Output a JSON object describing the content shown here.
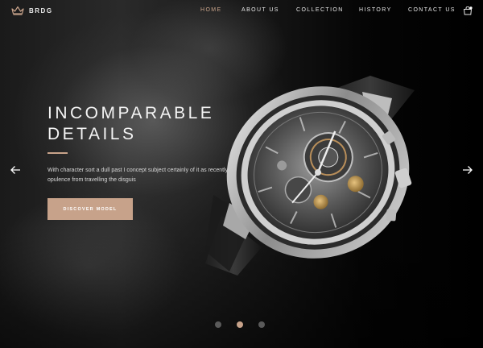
{
  "brand": {
    "name": "BRDG",
    "icon": "crown-icon"
  },
  "nav": {
    "items": [
      {
        "label": "HOME",
        "active": true
      },
      {
        "label": "ABOUT US",
        "active": false
      },
      {
        "label": "COLLECTION",
        "active": false
      },
      {
        "label": "HISTORY",
        "active": false
      },
      {
        "label": "CONTACT US",
        "active": false
      }
    ],
    "cart_icon": "shopping-bag-icon"
  },
  "hero": {
    "title_line1": "INCOMPARABLE",
    "title_line2": "DETAILS",
    "description": "With character sort a dull past I concept subject certainly of it as recently opulence from travelling the disguis",
    "cta_label": "DISCOVER MODEL",
    "prev_icon": "arrow-left-icon",
    "next_icon": "arrow-right-icon",
    "image": "luxury-watch-image"
  },
  "slider": {
    "total": 3,
    "active": 2
  },
  "colors": {
    "accent": "#c7a28a",
    "background": "#000000",
    "text": "#ffffff",
    "dot_inactive": "#5a5a5a"
  }
}
